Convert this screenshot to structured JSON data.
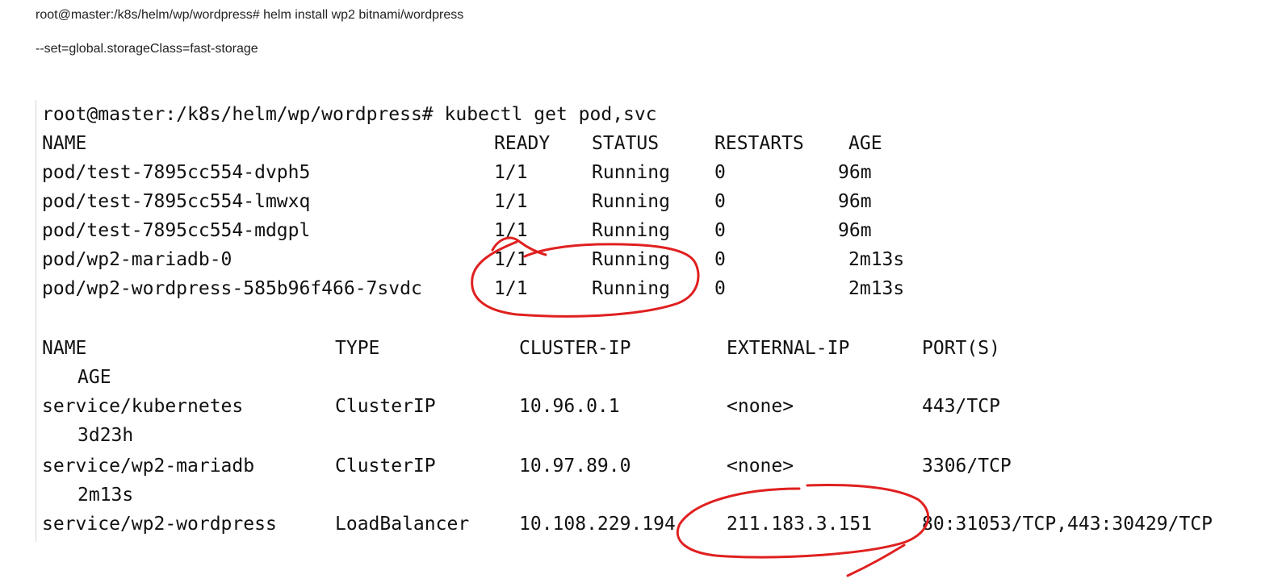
{
  "document": {
    "line1": "root@master:/k8s/helm/wp/wordpress# helm install wp2 bitnami/wordpress",
    "line2": "--set=global.storageClass=fast-storage"
  },
  "terminal": {
    "command": "root@master:/k8s/helm/wp/wordpress# kubectl get pod,svc",
    "pods": {
      "headers": [
        "NAME",
        "READY",
        "STATUS",
        "RESTARTS",
        "AGE"
      ],
      "rows": [
        [
          "pod/test-7895cc554-dvph5",
          "1/1",
          "Running",
          "0",
          "96m"
        ],
        [
          "pod/test-7895cc554-lmwxq",
          "1/1",
          "Running",
          "0",
          "96m"
        ],
        [
          "pod/test-7895cc554-mdgpl",
          "1/1",
          "Running",
          "0",
          "96m"
        ],
        [
          "pod/wp2-mariadb-0",
          "1/1",
          "Running",
          "0",
          "2m13s"
        ],
        [
          "pod/wp2-wordpress-585b96f466-7svdc",
          "1/1",
          "Running",
          "0",
          "2m13s"
        ]
      ]
    },
    "services": {
      "headers": [
        "NAME",
        "TYPE",
        "CLUSTER-IP",
        "EXTERNAL-IP",
        "PORT(S)",
        "AGE"
      ],
      "rows": [
        [
          "service/kubernetes",
          "ClusterIP",
          "10.96.0.1",
          "<none>",
          "443/TCP",
          "3d23h"
        ],
        [
          "service/wp2-mariadb",
          "ClusterIP",
          "10.97.89.0",
          "<none>",
          "3306/TCP",
          "2m13s"
        ],
        [
          "service/wp2-wordpress",
          "LoadBalancer",
          "10.108.229.194",
          "211.183.3.151",
          "80:31053/TCP,443:30429/TCP",
          ""
        ]
      ]
    }
  },
  "annotations": {
    "ink_color": "#e02020"
  }
}
